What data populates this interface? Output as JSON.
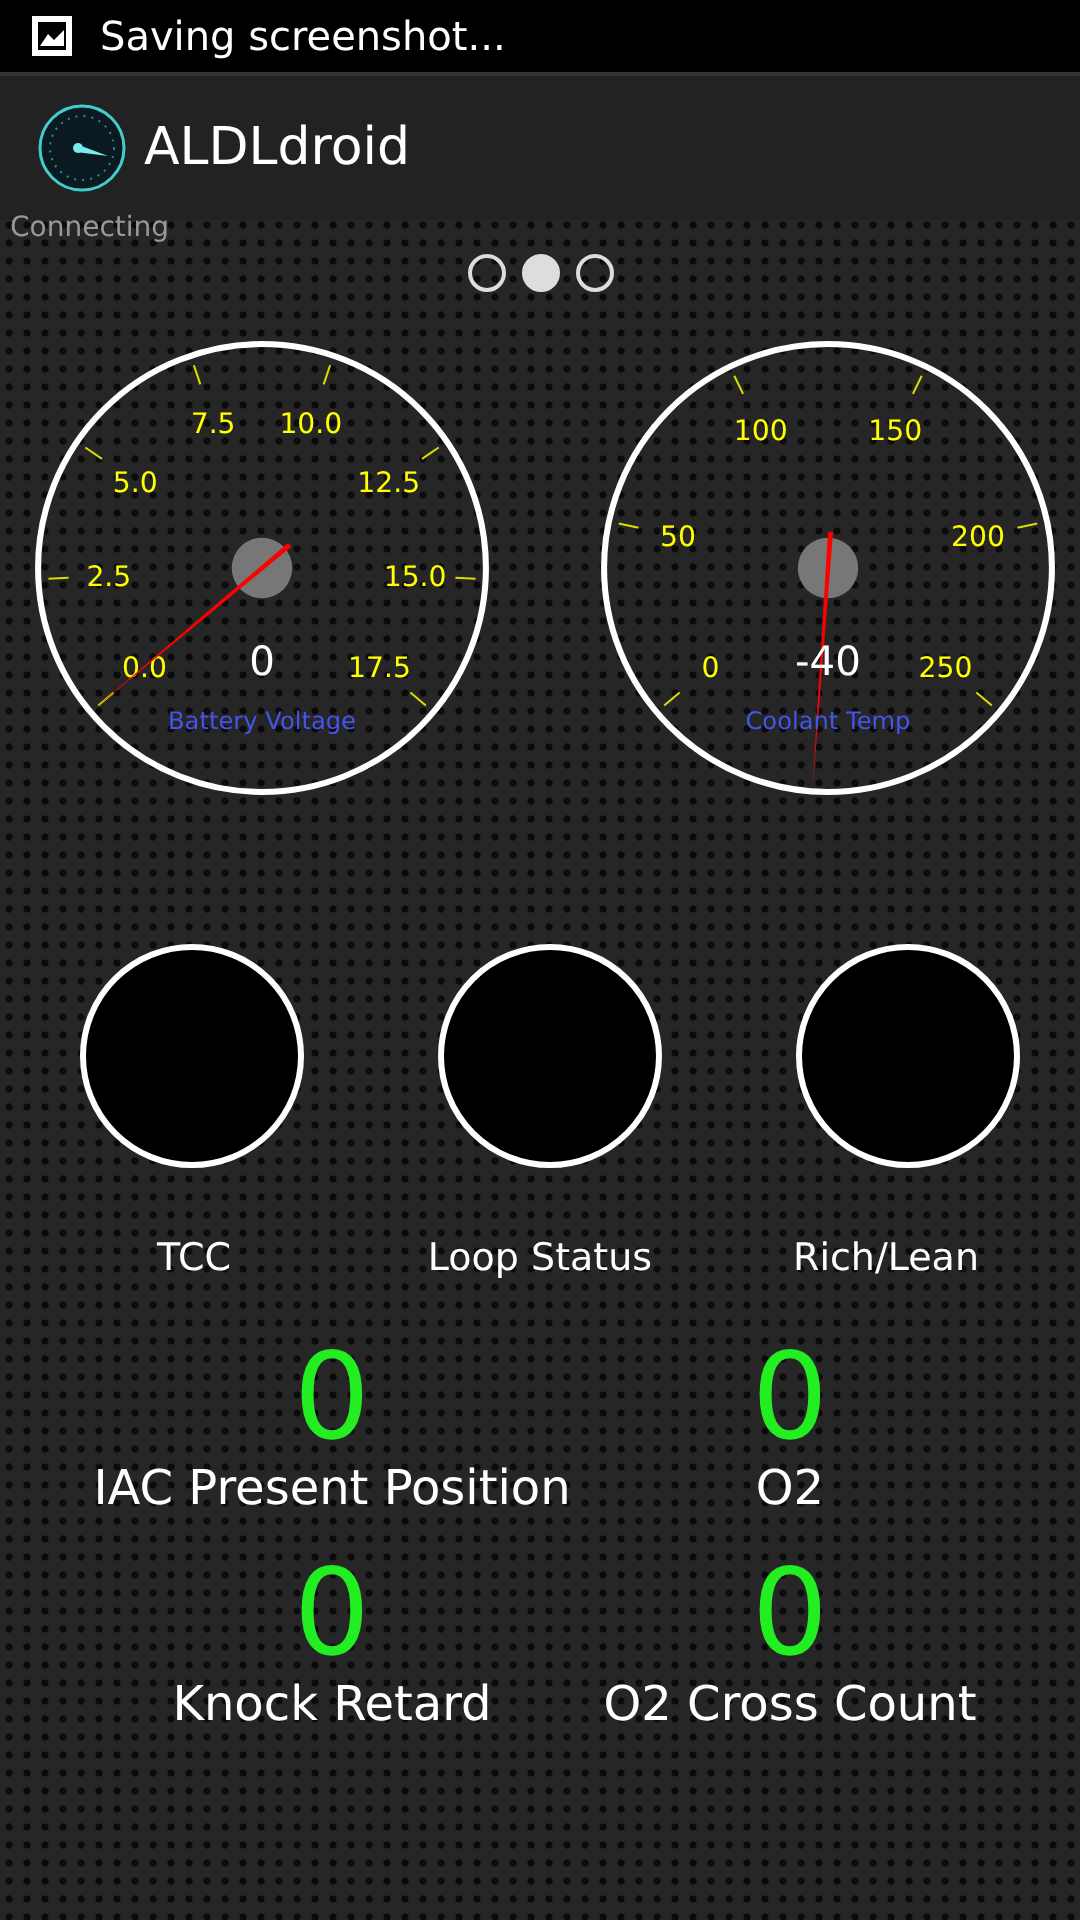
{
  "status_bar": {
    "text": "Saving screenshot..."
  },
  "action_bar": {
    "title": "ALDLdroid"
  },
  "connection_status": "Connecting",
  "pages": [
    {
      "selected": false
    },
    {
      "selected": true
    },
    {
      "selected": false
    }
  ],
  "gauges": [
    {
      "title": "Battery Voltage",
      "reading": "0",
      "ticks": [
        "0.0",
        "2.5",
        "5.0",
        "7.5",
        "10.0",
        "12.5",
        "15.0",
        "17.5"
      ]
    },
    {
      "title": "Coolant Temp",
      "reading": "-40",
      "ticks": [
        "0",
        "50",
        "100",
        "150",
        "200",
        "250"
      ]
    }
  ],
  "indicators": [
    {
      "label": "TCC"
    },
    {
      "label": "Loop Status"
    },
    {
      "label": "Rich/Lean"
    }
  ],
  "readouts": [
    {
      "value": "0",
      "label": "IAC Present Position"
    },
    {
      "value": "0",
      "label": "O2"
    },
    {
      "value": "0",
      "label": "Knock Retard"
    },
    {
      "value": "0",
      "label": "O2 Cross Count"
    }
  ]
}
